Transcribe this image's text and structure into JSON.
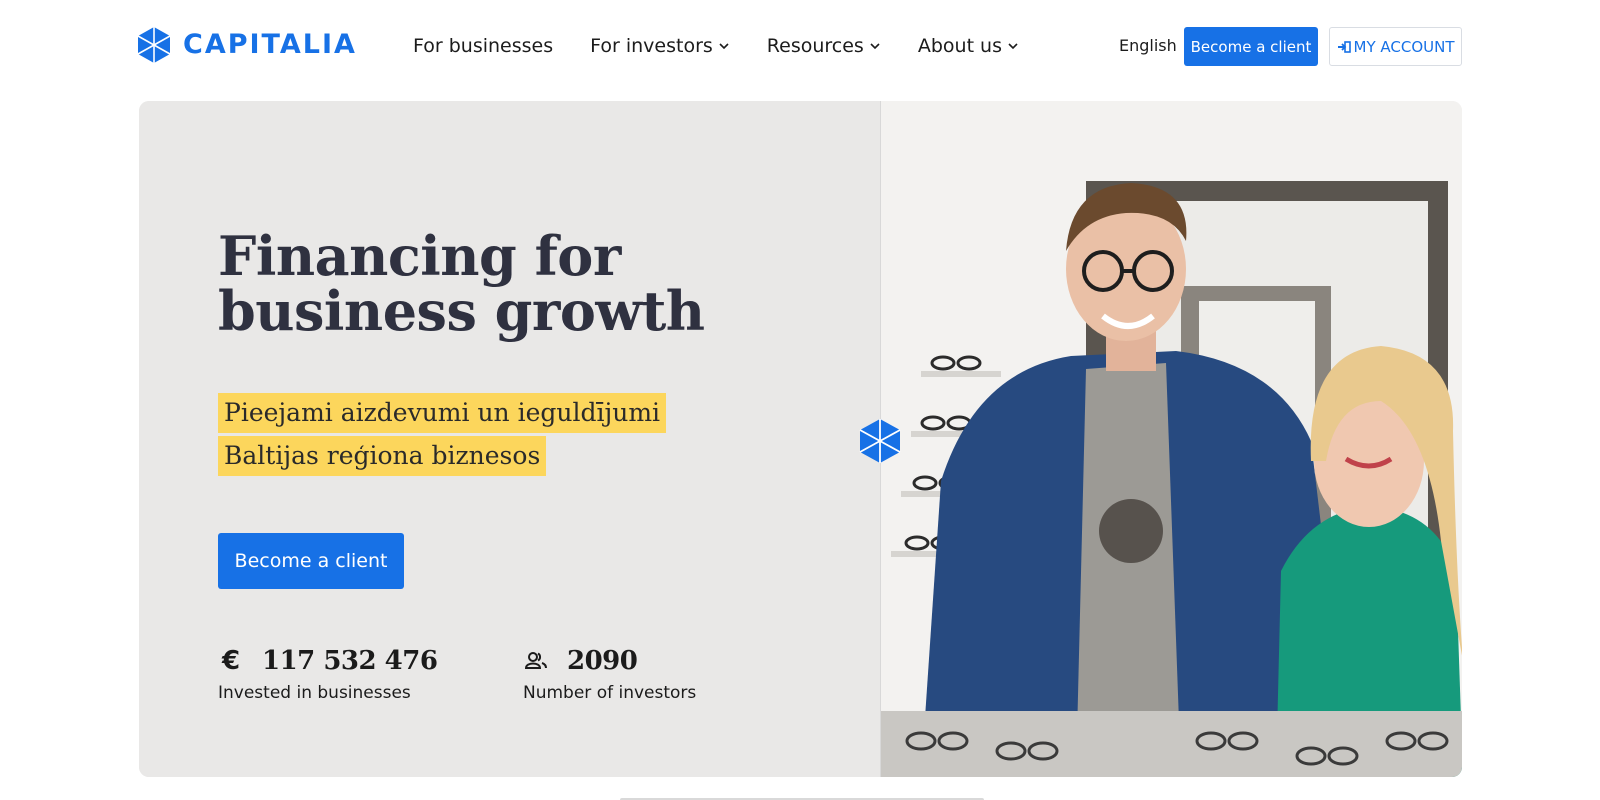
{
  "brand": {
    "name": "CAPITALIA",
    "color": "#1771e6",
    "icon": "hexagon-cube-icon"
  },
  "nav": {
    "items": [
      {
        "label": "For businesses",
        "has_dropdown": false
      },
      {
        "label": "For investors",
        "has_dropdown": true
      },
      {
        "label": "Resources",
        "has_dropdown": true
      },
      {
        "label": "About us",
        "has_dropdown": true
      }
    ],
    "dropdown_icon": "chevron-down-icon"
  },
  "header_actions": {
    "language": "English",
    "become_client": "Become a client",
    "account": "MY ACCOUNT",
    "account_icon": "sign-in-icon"
  },
  "hero": {
    "title_line1": "Financing for",
    "title_line2": "business growth",
    "subtitle_line1": "Pieejami aizdevumi un ieguldījumi",
    "subtitle_line2": "Baltijas reģiona biznesos",
    "cta": "Become a client",
    "highlight_color": "#fcd65c",
    "background_color": "#e9e8e7",
    "photo_alt_icon": "team-photo"
  },
  "stats": [
    {
      "icon": "euro-icon",
      "value": "117 532 476",
      "label": "Invested in businesses"
    },
    {
      "icon": "users-icon",
      "value": "2090",
      "label": "Number of investors"
    }
  ]
}
